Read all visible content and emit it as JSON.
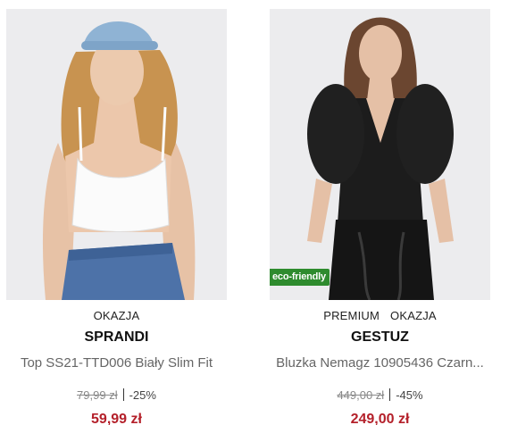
{
  "products": [
    {
      "tags": [
        "OKAZJA"
      ],
      "brand": "SPRANDI",
      "name": "Top SS21-TTD006 Biały Slim Fit",
      "old_price": "79,99 zł",
      "discount": "-25%",
      "price": "59,99 zł",
      "badge": ""
    },
    {
      "tags": [
        "PREMIUM",
        "OKAZJA"
      ],
      "brand": "GESTUZ",
      "name": "Bluzka Nemagz 10905436 Czarn...",
      "old_price": "449,00 zł",
      "discount": "-45%",
      "price": "249,00 zł",
      "badge": "eco-friendly"
    }
  ],
  "colors": {
    "sale_price": "#b4202a",
    "eco_badge": "#2e8b2e"
  }
}
